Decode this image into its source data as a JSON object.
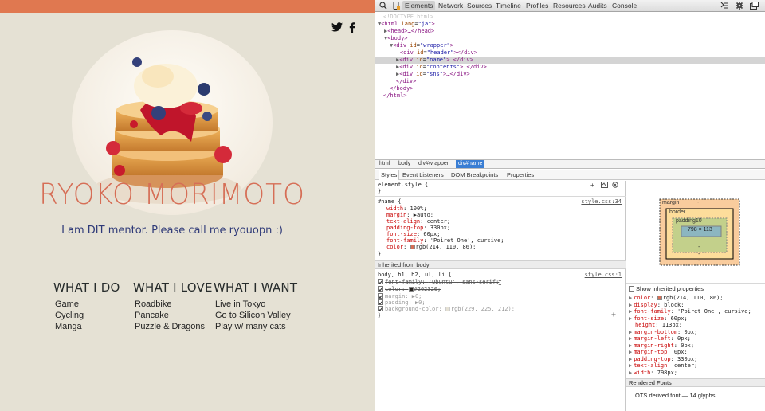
{
  "page": {
    "name": "RYOKO MORIMOTO",
    "tagline": "I am DIT mentor. Please call me ryouopn :)",
    "sns": {
      "twitter": "twitter-icon",
      "facebook": "facebook-icon"
    },
    "columns": [
      {
        "heading": "WHAT I DO",
        "items": [
          "Game",
          "Cycling",
          "Manga"
        ]
      },
      {
        "heading": "WHAT I LOVE",
        "items": [
          "Roadbike",
          "Pancake",
          "Puzzle & Dragons"
        ]
      },
      {
        "heading": "WHAT I WANT",
        "items": [
          "Live in Tokyo",
          "Go to Silicon Valley",
          "Play w/ many cats"
        ]
      }
    ],
    "colors": {
      "topbar": "#e07850",
      "background": "#e5e1d4",
      "name": "#d66e56",
      "tagline": "#2f3a78"
    }
  },
  "devtools": {
    "tabs": [
      "Elements",
      "Network",
      "Sources",
      "Timeline",
      "Profiles",
      "Resources",
      "Audits",
      "Console"
    ],
    "active_tab": "Elements",
    "dom": {
      "doctype": "<!DOCTYPE html>",
      "html_open": "<html",
      "html_attr": "lang",
      "html_val": "\"ja\"",
      "head": "<head>…</head>",
      "body_open": "<body>",
      "wrapper_open": "<div",
      "wrapper_attr": "id",
      "wrapper_val": "\"wrapper\"",
      "rows": [
        {
          "id": "\"header\"",
          "tail": "></div>"
        },
        {
          "id": "\"name\"",
          "tail": ">…</div>"
        },
        {
          "id": "\"contents\"",
          "tail": ">…</div>"
        },
        {
          "id": "\"sns\"",
          "tail": ">…</div>"
        }
      ],
      "div_close": "</div>",
      "body_close": "</body>",
      "html_close": "</html>"
    },
    "breadcrumbs": [
      "html",
      "body",
      "div#wrapper",
      "div#name"
    ],
    "subtabs": [
      "Styles",
      "Event Listeners",
      "DOM Breakpoints",
      "Properties"
    ],
    "styles": {
      "element_style": "element.style {",
      "close": "}",
      "rule_selector": "#name {",
      "rule_source": "style.css:34",
      "rule_props": [
        {
          "p": "width",
          "v": "100%;"
        },
        {
          "p": "margin",
          "v": "▶auto;"
        },
        {
          "p": "text-align",
          "v": "center;"
        },
        {
          "p": "padding-top",
          "v": "330px;"
        },
        {
          "p": "font-size",
          "v": "60px;"
        },
        {
          "p": "font-family",
          "v": "'Poiret One', cursive;"
        },
        {
          "p": "color",
          "v": "rgb(214, 110, 86);"
        }
      ],
      "inherited_label": "Inherited from",
      "inherited_link": "body",
      "rule2_selector": "body, h1, h2, ul, li {",
      "rule2_source": "style.css:1",
      "rule2_props": [
        {
          "p": "font-family",
          "v": "'Ubuntu', sans-serif;"
        },
        {
          "p": "color",
          "v": "#262320;"
        },
        {
          "p": "margin",
          "v": "▶0;"
        },
        {
          "p": "padding",
          "v": "▶0;"
        },
        {
          "p": "background-color",
          "v": "rgb(229, 225, 212);"
        }
      ]
    },
    "metrics": {
      "margin": "margin",
      "border": "border",
      "padding": "padding10",
      "content": "798 × 113",
      "dash": "-"
    },
    "computed": {
      "show_inherited": "Show inherited properties",
      "props": [
        {
          "p": "color",
          "v": "rgb(214, 110, 86);"
        },
        {
          "p": "display",
          "v": "block;"
        },
        {
          "p": "font-family",
          "v": "'Poiret One', cursive;"
        },
        {
          "p": "font-size",
          "v": "60px;"
        },
        {
          "p": "height",
          "v": "113px;"
        },
        {
          "p": "margin-bottom",
          "v": "0px;"
        },
        {
          "p": "margin-left",
          "v": "0px;"
        },
        {
          "p": "margin-right",
          "v": "0px;"
        },
        {
          "p": "margin-top",
          "v": "0px;"
        },
        {
          "p": "padding-top",
          "v": "330px;"
        },
        {
          "p": "text-align",
          "v": "center;"
        },
        {
          "p": "width",
          "v": "798px;"
        }
      ],
      "rendered_fonts": "Rendered Fonts",
      "font_info": "OTS derived font — 14 glyphs"
    }
  }
}
